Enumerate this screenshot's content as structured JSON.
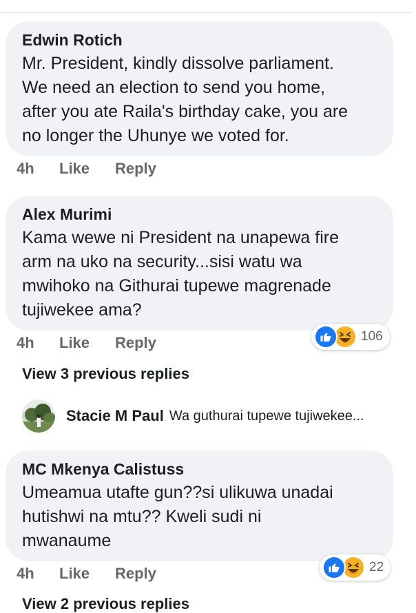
{
  "comments": [
    {
      "author": "Edwin Rotich",
      "lines": [
        "Mr. President, kindly dissolve parliament.",
        "We need an election to send you home,",
        "after you ate Raila's birthday cake, you are",
        "no longer the Uhunye we voted for."
      ],
      "time": "4h",
      "like_label": "Like",
      "reply_label": "Reply"
    },
    {
      "author": "Alex Murimi",
      "lines": [
        "Kama wewe ni President na unapewa fire",
        "arm na uko na security...sisi watu wa",
        "mwihoko na Githurai tupewe magrenade",
        "tujiwekee ama?"
      ],
      "time": "4h",
      "like_label": "Like",
      "reply_label": "Reply",
      "reaction_count": "106",
      "view_replies": "View 3 previous replies",
      "latest_reply": {
        "author": "Stacie M Paul",
        "text": "Wa guthurai tupewe tujiwekee..."
      }
    },
    {
      "author": "MC Mkenya Calistuss",
      "lines": [
        "Umeamua utafte gun??si ulikuwa unadai",
        "hutishwi na mtu?? Kweli sudi ni",
        "mwanaume"
      ],
      "time": "4h",
      "like_label": "Like",
      "reply_label": "Reply",
      "reaction_count": "22",
      "view_replies": "View 2 previous replies"
    }
  ],
  "icons": {
    "like_reaction": "thumbs-up-icon",
    "haha_reaction": "haha-face-icon"
  },
  "colors": {
    "bubble": "#f0f2f5",
    "like_blue": "#1877f2",
    "haha_yellow": "#f7b125",
    "meta_gray": "#65676b"
  }
}
